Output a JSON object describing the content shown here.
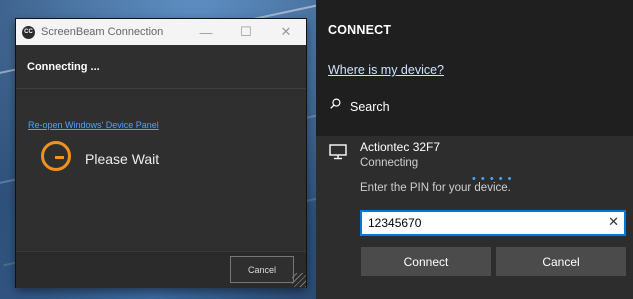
{
  "screenbeam": {
    "logo_text": "CC",
    "title": "ScreenBeam Connection",
    "minimize": "—",
    "maximize": "☐",
    "close": "✕",
    "status": "Connecting ...",
    "link": "Re-open Windows' Device Panel",
    "wait": "Please Wait",
    "cancel": "Cancel"
  },
  "connect": {
    "title": "CONNECT",
    "device_link": "Where is my device?",
    "search": "Search",
    "device": {
      "name": "Actiontec 32F7",
      "status": "Connecting",
      "progress_dots": "• • • • •",
      "pin_prompt": "Enter the PIN for your device.",
      "pin_value": "12345670",
      "clear_icon": "✕",
      "connect_label": "Connect",
      "cancel_label": "Cancel"
    }
  },
  "colors": {
    "spinner": "#f0921e",
    "accent": "#0078d7",
    "link": "#4ea3ff"
  }
}
